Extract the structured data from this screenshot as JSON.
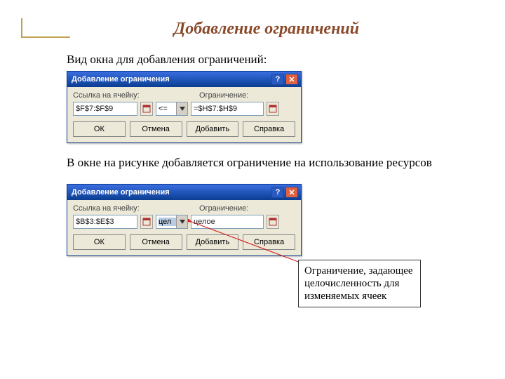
{
  "page_title": "Добавление ограничений",
  "intro1": "Вид окна для добавления ограничений:",
  "intro2": "В окне на рисунке добавляется ограничение на использование ресурсов",
  "labels": {
    "cell_ref": "Ссылка на ячейку:",
    "constraint": "Ограничение:"
  },
  "dialog1": {
    "title": "Добавление ограничения",
    "cell_ref": "$F$7:$F$9",
    "operator": "<=",
    "constraint": "=$H$7:$H$9"
  },
  "dialog2": {
    "title": "Добавление ограничения",
    "cell_ref": "$B$3:$E$3",
    "operator": "цел",
    "constraint": "целое"
  },
  "buttons": {
    "ok": "ОК",
    "cancel": "Отмена",
    "add": "Добавить",
    "help": "Справка"
  },
  "callout": "Ограничение, задающее целочисленность для изменяемых ячеек"
}
